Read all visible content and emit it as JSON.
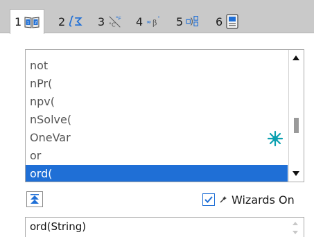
{
  "tabs": [
    {
      "number": "1",
      "icon": "catalog-book-icon",
      "active": true
    },
    {
      "number": "2",
      "icon": "math-templates-icon",
      "active": false
    },
    {
      "number": "3",
      "icon": "symbols-icon",
      "active": false
    },
    {
      "number": "4",
      "icon": "library-icon",
      "active": false
    },
    {
      "number": "5",
      "icon": "units-icon",
      "active": false
    },
    {
      "number": "6",
      "icon": "documents-icon",
      "active": false
    }
  ],
  "catalog": {
    "items": [
      "not",
      "nPr(",
      "npv(",
      "nSolve(",
      "OneVar",
      "or",
      "ord("
    ],
    "selected_index": 6,
    "scroll_position": 0.56
  },
  "wizards": {
    "label": "Wizards On",
    "checked": true
  },
  "syntax": {
    "text": "ord(String)"
  },
  "colors": {
    "selection": "#1f6fd6",
    "accent": "#0aa0b0",
    "tabbar": "#c9c9c9"
  }
}
